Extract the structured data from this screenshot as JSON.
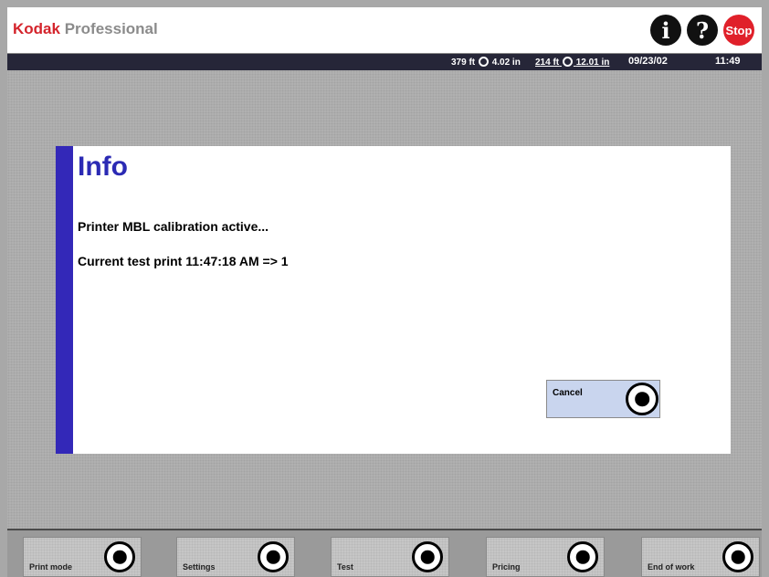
{
  "header": {
    "brand_name": "Kodak",
    "brand_suffix": "Professional",
    "info_icon": "i",
    "help_icon": "?",
    "stop_label": "Stop"
  },
  "status": {
    "reel1_length": "379 ft",
    "reel1_width": "4.02 in",
    "reel2_length": "214 ft",
    "reel2_width": "12.01 in",
    "date": "09/23/02",
    "time": "11:49"
  },
  "dialog": {
    "title": "Info",
    "message": "Printer MBL calibration active...",
    "detail": "Current test print 11:47:18 AM => 1",
    "cancel_label": "Cancel"
  },
  "footer": {
    "buttons": [
      {
        "label": "Print mode"
      },
      {
        "label": "Settings"
      },
      {
        "label": "Test"
      },
      {
        "label": "Pricing"
      },
      {
        "label": "End of work"
      }
    ]
  },
  "colors": {
    "accent": "#2b2ab4",
    "brand_red": "#d4242c",
    "status_bar": "#262638",
    "cancel_bg": "#c9d5ee"
  }
}
